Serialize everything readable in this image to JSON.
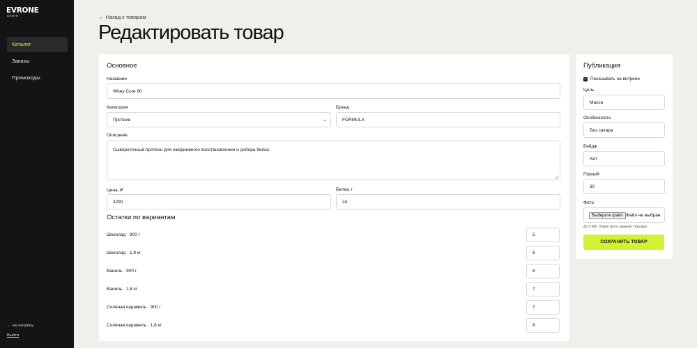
{
  "sidebar": {
    "logo": "EVRONE",
    "logo_sub": "ADMIN",
    "items": [
      {
        "label": "Каталог",
        "active": true
      },
      {
        "label": "Заказы",
        "active": false
      },
      {
        "label": "Промокоды",
        "active": false
      }
    ],
    "storefront_link": "← На витрину",
    "logout_link": "Выйти"
  },
  "header": {
    "back_link": "← Назад к товарам",
    "title": "Редактировать товар"
  },
  "main": {
    "section_title": "Основное",
    "name": {
      "label": "Название",
      "value": "Whey Core 80"
    },
    "category": {
      "label": "Категория",
      "value": "Протеин"
    },
    "brand": {
      "label": "Бренд",
      "value": "FORMULA"
    },
    "description": {
      "label": "Описание",
      "value": "Сывороточный протеин для ежедневного восстановления и добора белка."
    },
    "price": {
      "label": "Цена, ₽",
      "value": "3290"
    },
    "protein": {
      "label": "Белка, г",
      "value": "24"
    },
    "stock_title": "Остатки по вариантам",
    "variants": [
      {
        "label": "Шоколад · 900 г",
        "qty": "5"
      },
      {
        "label": "Шоколад · 1,8 кг",
        "qty": "6"
      },
      {
        "label": "Ваниль · 900 г",
        "qty": "6"
      },
      {
        "label": "Ваниль · 1,8 кг",
        "qty": "7"
      },
      {
        "label": "Солёная карамель · 900 г",
        "qty": "7"
      },
      {
        "label": "Солёная карамель · 1,8 кг",
        "qty": "8"
      }
    ]
  },
  "publication": {
    "title": "Публикация",
    "show_label": "Показывать на витрине",
    "show_checked": true,
    "goal": {
      "label": "Цель",
      "value": "Масса"
    },
    "feature": {
      "label": "Особенность",
      "value": "Без сахара"
    },
    "badge": {
      "label": "Бейдж",
      "value": "Хит"
    },
    "servings": {
      "label": "Порций",
      "value": "30"
    },
    "photo": {
      "label": "Фото",
      "button": "Выберите файл",
      "status": "Файл не выбран",
      "hint": "До 5 МБ. Новое фото заменит текущее."
    },
    "save_button": "СОХРАНИТЬ ТОВАР"
  },
  "colors": {
    "accent": "#cff235",
    "sidebar_bg": "#141414",
    "page_bg": "#eff0ea"
  }
}
